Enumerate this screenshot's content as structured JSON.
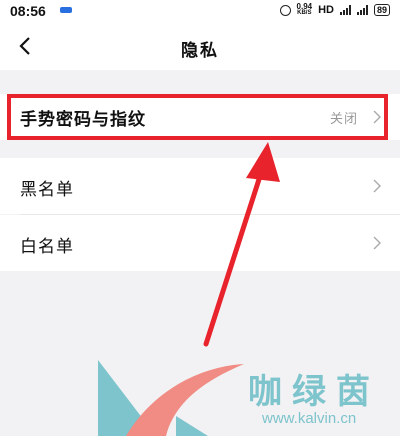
{
  "status_bar": {
    "time": "08:56",
    "net_speed_value": "0.94",
    "net_speed_unit": "KB/S",
    "hd_label": "HD",
    "battery": "89"
  },
  "header": {
    "title": "隐私"
  },
  "settings": {
    "gesture_password": {
      "label": "手势密码与指纹",
      "value": "关闭"
    },
    "blacklist": {
      "label": "黑名单"
    },
    "whitelist": {
      "label": "白名单"
    }
  },
  "watermark": {
    "brand": "咖绿茵",
    "url": "www.kalvin.cn"
  },
  "colors": {
    "highlight": "#e8232b",
    "watermark": "#7dc4cc",
    "background": "#f2f2f4"
  },
  "icons": {
    "back": "back-arrow-icon",
    "chevron": "chevron-right-icon",
    "alarm": "alarm-icon",
    "signal": "signal-icon",
    "battery": "battery-icon"
  }
}
